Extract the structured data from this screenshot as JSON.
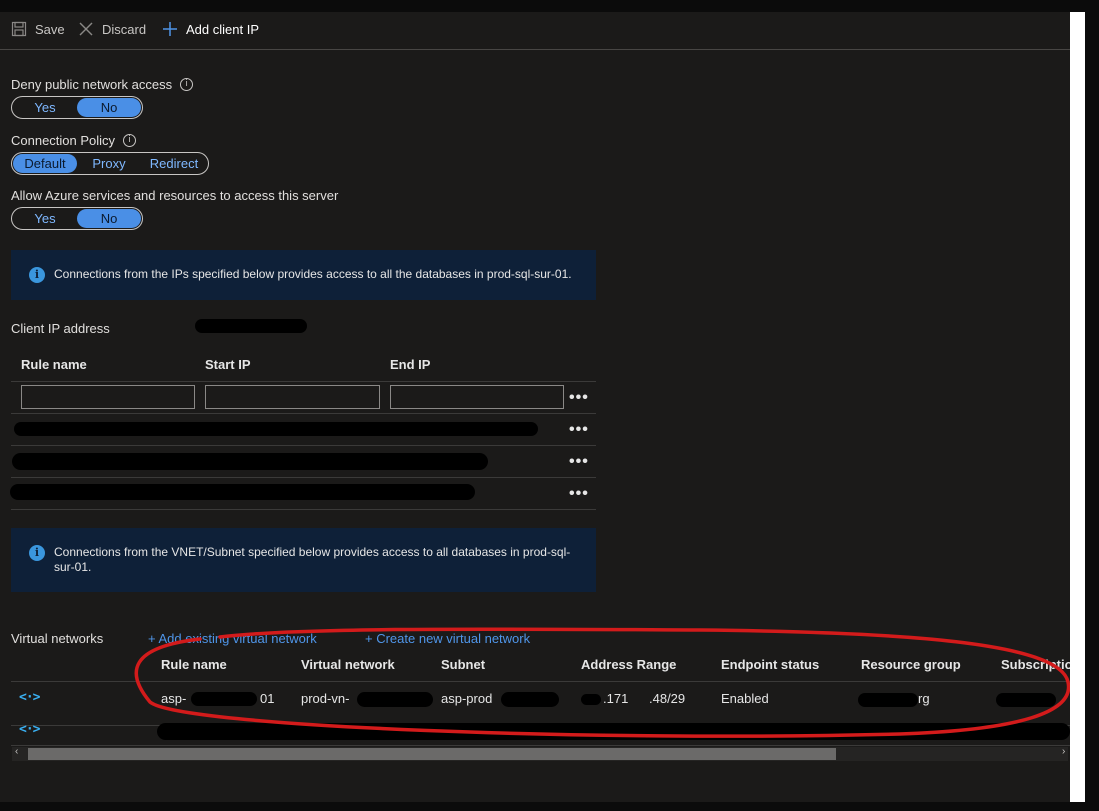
{
  "toolbar": {
    "save_label": "Save",
    "discard_label": "Discard",
    "add_client_ip_label": "Add client IP"
  },
  "deny_public": {
    "label": "Deny public network access",
    "options": [
      "Yes",
      "No"
    ],
    "selected": "No"
  },
  "connection_policy": {
    "label": "Connection Policy",
    "options": [
      "Default",
      "Proxy",
      "Redirect"
    ],
    "selected": "Default"
  },
  "allow_azure": {
    "label": "Allow Azure services and resources to access this server",
    "options": [
      "Yes",
      "No"
    ],
    "selected": "No"
  },
  "ip_banner": {
    "text": "Connections from the IPs specified below provides access to all the databases in prod-sql-sur-01."
  },
  "client_ip": {
    "label": "Client IP address"
  },
  "firewall_table": {
    "headers": [
      "Rule name",
      "Start IP",
      "End IP"
    ],
    "more_label": "•••"
  },
  "vnet_banner": {
    "text_line1": "Connections from the VNET/Subnet specified below provides access to all databases in prod-sql-",
    "text_line2": "sur-01."
  },
  "virtual_networks": {
    "label": "Virtual networks",
    "add_existing_label": "+ Add existing virtual network",
    "create_new_label": "+ Create new virtual network",
    "headers": [
      "Rule name",
      "Virtual network",
      "Subnet",
      "Address Range",
      "Endpoint status",
      "Resource group",
      "Subscriptio"
    ],
    "rows": [
      {
        "rule_name_start": "asp-",
        "rule_name_end": "01",
        "virtual_network": "prod-vn-",
        "subnet": "asp-prod",
        "address_range_a": ".171",
        "address_range_b": ".48/29",
        "endpoint_status": "Enabled",
        "resource_group": "rg"
      }
    ]
  },
  "colors": {
    "background": "#1b1a19",
    "accent": "#4a8fe6",
    "link": "#4f95e8",
    "banner": "#0e2038",
    "annotation": "#d31b1b"
  }
}
